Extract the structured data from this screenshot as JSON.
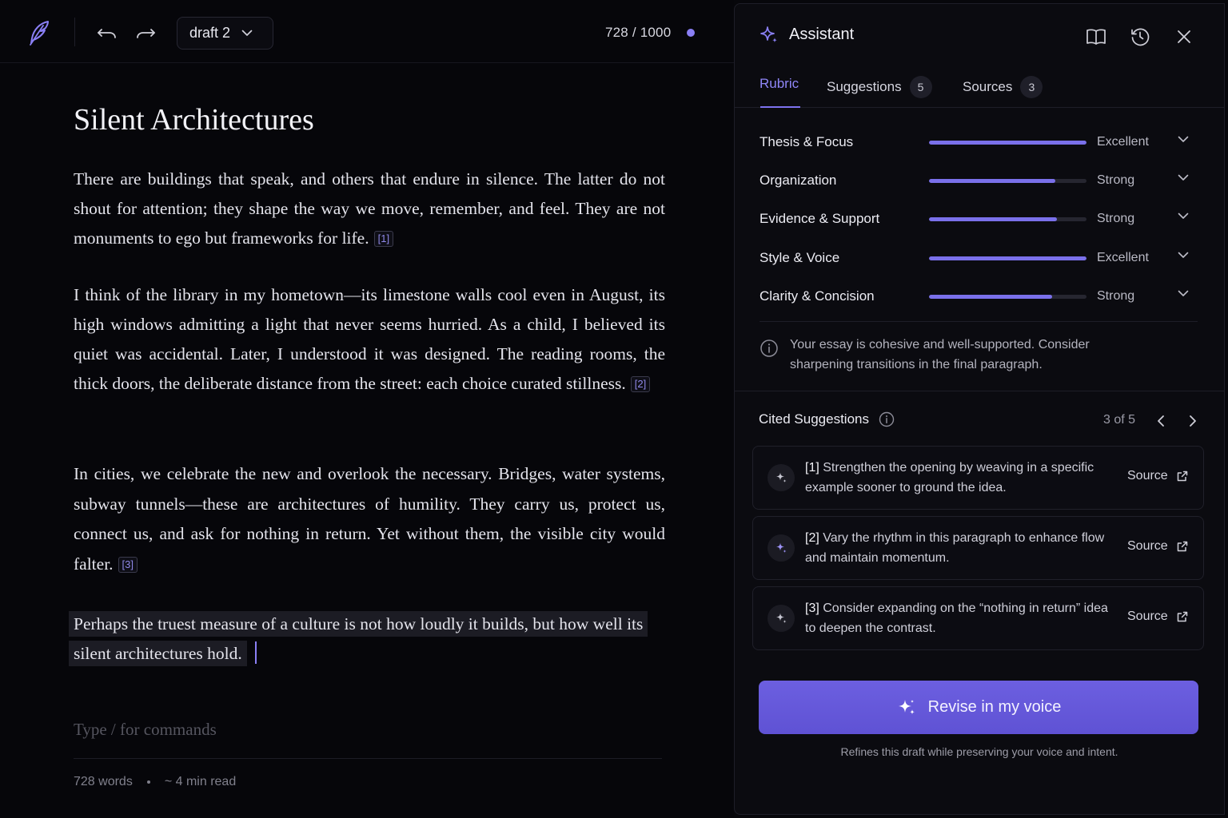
{
  "editor": {
    "draft_label": "draft 2",
    "word_progress": "728 / 1000",
    "title": "Silent Architectures",
    "paragraphs": [
      {
        "text": "There are buildings that speak, and others that endure in silence. The latter do not shout for attention; they shape the way we move, remember, and feel. They are not monuments to ego but frameworks for life.",
        "cite": "[1]"
      },
      {
        "text": "I think of the library in my hometown—its limestone walls cool even in August, its high windows admitting a light that never seems hurried. As a child, I believed its quiet was accidental. Later, I understood it was designed. The reading rooms, the thick doors, the deliberate distance from the street: each choice curated stillness.",
        "cite": "[2]"
      },
      {
        "text": "In cities, we celebrate the new and overlook the necessary. Bridges, water systems, subway tunnels—these are architectures of humility. They carry us, protect us, connect us, and ask for nothing in return. Yet without them, the visible city would falter.",
        "cite": "[3]"
      },
      {
        "text": "Perhaps the truest measure of a culture is not how loudly it builds, but how well its silent architectures hold."
      }
    ],
    "command_placeholder": "Type / for commands",
    "footer": {
      "words": "728 words",
      "read_time": "~ 4 min read"
    }
  },
  "assistant": {
    "title": "Assistant",
    "tabs": [
      {
        "label": "Rubric"
      },
      {
        "label": "Suggestions",
        "count": "5"
      },
      {
        "label": "Sources",
        "count": "3"
      }
    ],
    "rubric": [
      {
        "label": "Thesis & Focus",
        "rating": "Excellent",
        "level": 1.0
      },
      {
        "label": "Organization",
        "rating": "Strong",
        "level": 0.8
      },
      {
        "label": "Evidence & Support",
        "rating": "Strong",
        "level": 0.81
      },
      {
        "label": "Style & Voice",
        "rating": "Excellent",
        "level": 1.0
      },
      {
        "label": "Clarity & Concision",
        "rating": "Strong",
        "level": 0.78
      }
    ],
    "summary": "Your essay is cohesive and well-supported. Consider sharpening transitions in the final paragraph.",
    "cited": {
      "heading": "Cited Suggestions",
      "pager": "3 of 5",
      "items": [
        {
          "num": "[1]",
          "text": "Strengthen the opening by weaving in a specific example sooner to ground the idea.",
          "source_label": "Source"
        },
        {
          "num": "[2]",
          "text": "Vary the rhythm in this paragraph to enhance flow and maintain momentum.",
          "source_label": "Source"
        },
        {
          "num": "[3]",
          "text": "Consider expanding on the “nothing in return” idea to deepen the contrast.",
          "source_label": "Source"
        }
      ]
    },
    "revise_label": "Revise in my voice",
    "revise_note": "Refines this draft while preserving your voice and intent."
  },
  "colors": {
    "accent": "#7a70ea",
    "background": "#07070b",
    "panel": "#0b0b10"
  },
  "icons": [
    "quill-logo-icon",
    "undo-icon",
    "redo-icon",
    "chevron-down-icon",
    "sparkle-icon",
    "book-icon",
    "history-icon",
    "close-icon",
    "info-icon",
    "chevron-left-icon",
    "chevron-right-icon",
    "external-link-icon"
  ]
}
